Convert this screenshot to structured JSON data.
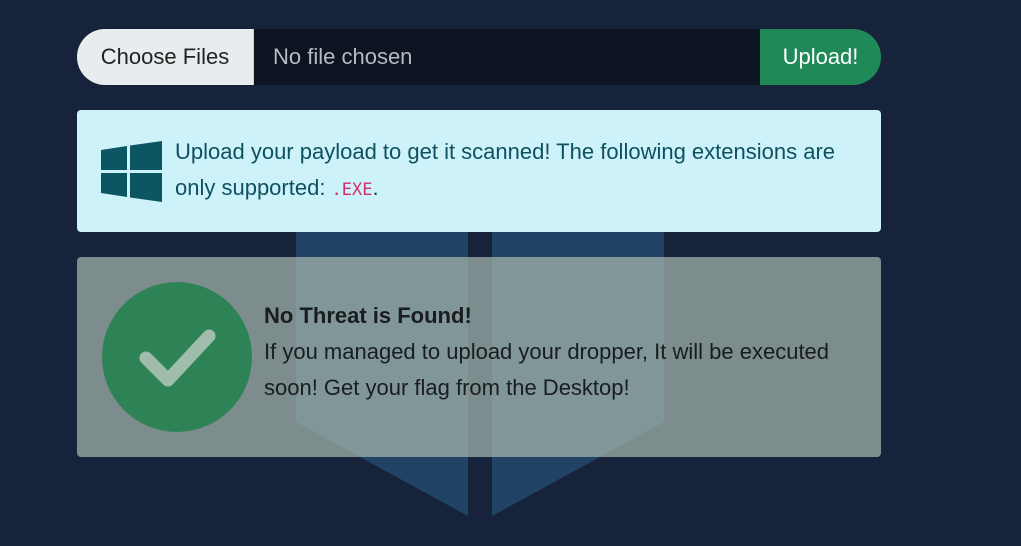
{
  "upload": {
    "choose_label": "Choose Files",
    "file_status": "No file chosen",
    "submit_label": "Upload!"
  },
  "info": {
    "icon": "windows-logo-icon",
    "text_prefix": "Upload your payload to get it scanned! The following extensions are only supported: ",
    "extension": ".EXE",
    "text_suffix": "."
  },
  "result": {
    "icon": "check-circle-icon",
    "title": "No Threat is Found!",
    "message": "If you managed to upload your dropper, It will be executed soon! Get your flag from the Desktop!"
  },
  "colors": {
    "background": "#16233a",
    "upload_button": "#1f8a57",
    "info_bg": "#cdf2f9",
    "info_text": "#0e5160",
    "check_circle": "#2e8356",
    "code": "#d1306a"
  }
}
